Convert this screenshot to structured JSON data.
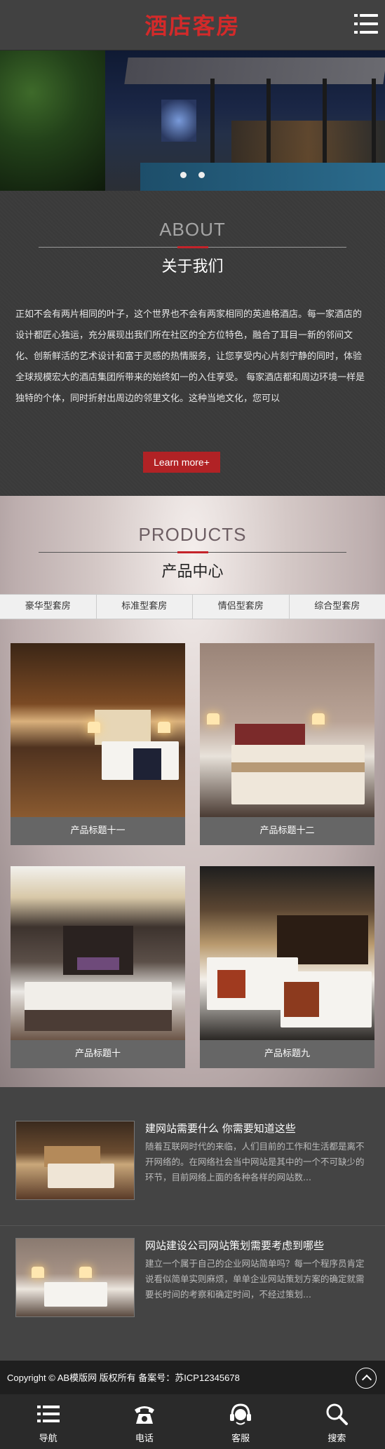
{
  "header": {
    "logo_text": "酒店客房",
    "menu_icon": "hamburger-menu-icon"
  },
  "banner": {
    "slide_count": 2,
    "active_slide": 1
  },
  "about": {
    "title_en": "ABOUT",
    "title_cn": "关于我们",
    "body": "正如不会有两片相同的叶子，这个世界也不会有两家相同的英迪格酒店。每一家酒店的设计都匠心独运，充分展现出我们所在社区的全方位特色，融合了耳目一新的邻间文化、创新鲜活的艺术设计和富于灵感的热情服务，让您享受内心片刻宁静的同时，体验全球规模宏大的酒店集团所带来的始终如一的入住享受。 每家酒店都和周边环境一样是独特的个体，同时折射出周边的邻里文化。这种当地文化，您可以",
    "button_label": "Learn more+",
    "accent_color": "#b12225"
  },
  "products": {
    "title_en": "PRODUCTS",
    "title_cn": "产品中心",
    "tabs": [
      "豪华型套房",
      "标准型套房",
      "情侣型套房",
      "综合型套房"
    ],
    "items": [
      {
        "title": "产品标题十一"
      },
      {
        "title": "产品标题十二"
      },
      {
        "title": "产品标题十"
      },
      {
        "title": "产品标题九"
      }
    ]
  },
  "news": {
    "items": [
      {
        "title": "建网站需要什么 你需要知道这些",
        "desc": "随着互联网时代的来临，人们目前的工作和生活都是离不开网络的。在网络社会当中网站是其中的一个不可缺少的环节，目前网络上面的各种各样的网站数..."
      },
      {
        "title": "网站建设公司网站策划需要考虑到哪些",
        "desc": "建立一个属于自己的企业网站简单吗？每一个程序员肯定说看似简单实则麻烦，单单企业网站策划方案的确定就需要长时间的考察和确定时间，不经过策划..."
      }
    ]
  },
  "footer": {
    "copyright": "Copyright © AB模版网 版权所有 备案号：苏ICP12345678",
    "nav": [
      {
        "label": "导航",
        "icon": "list-icon"
      },
      {
        "label": "电话",
        "icon": "phone-icon"
      },
      {
        "label": "客服",
        "icon": "headset-icon"
      },
      {
        "label": "搜索",
        "icon": "search-icon"
      }
    ]
  }
}
